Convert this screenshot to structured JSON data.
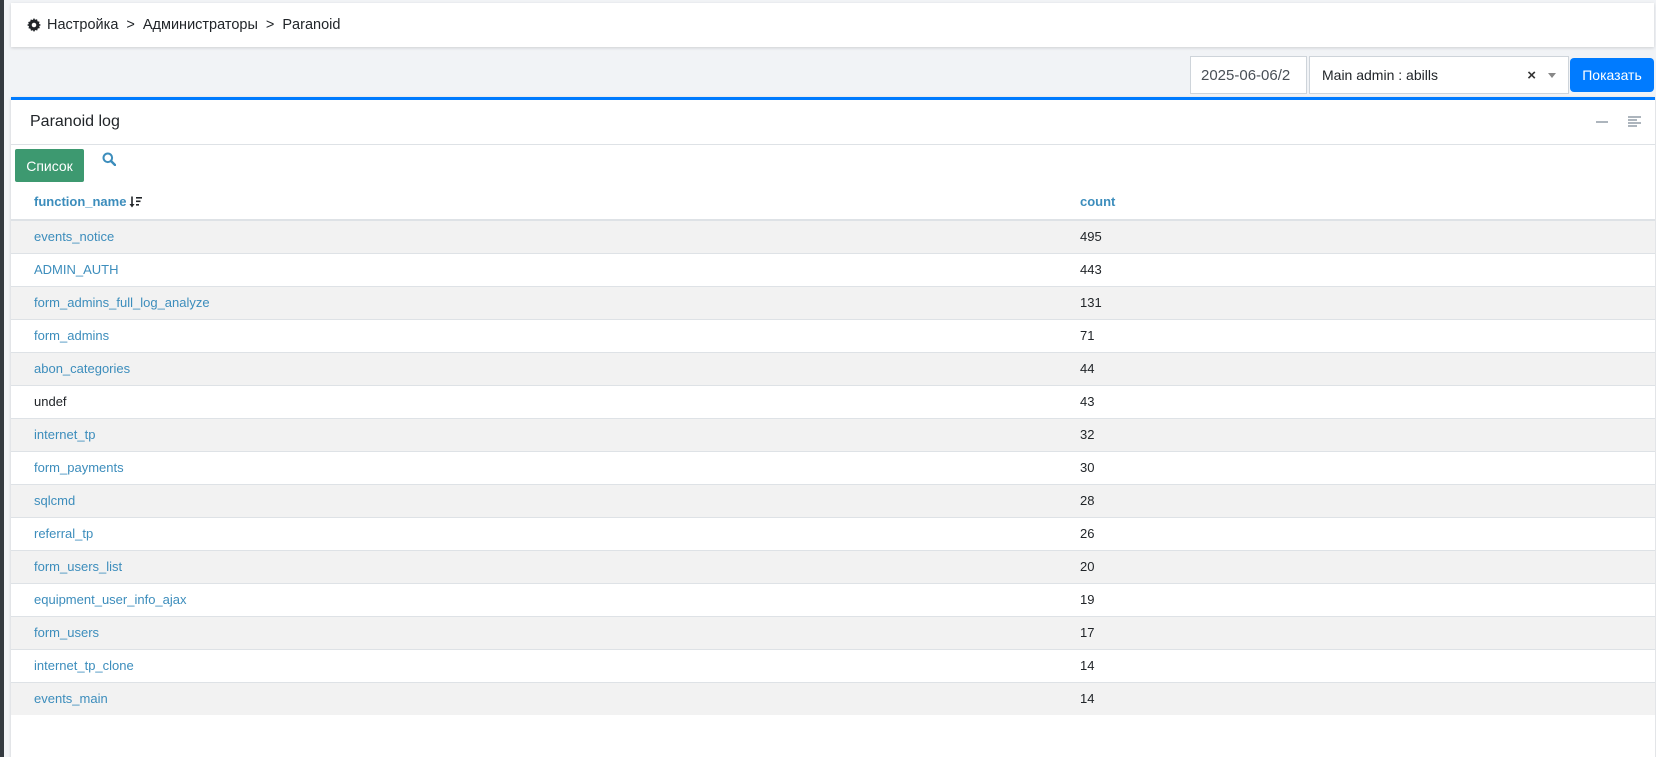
{
  "breadcrumb": {
    "items": [
      "Настройка",
      "Администраторы",
      "Paranoid"
    ],
    "separator": ">"
  },
  "filter": {
    "date_value": "2025-06-06/2",
    "admin_select_value": "Main admin : abills",
    "clear_symbol": "×",
    "show_button": "Показать"
  },
  "card": {
    "title": "Paranoid log",
    "list_button": "Список"
  },
  "table": {
    "columns": [
      "function_name",
      "count"
    ],
    "rows": [
      {
        "function_name": "events_notice",
        "count": "495",
        "link": true
      },
      {
        "function_name": "ADMIN_AUTH",
        "count": "443",
        "link": true
      },
      {
        "function_name": "form_admins_full_log_analyze",
        "count": "131",
        "link": true
      },
      {
        "function_name": "form_admins",
        "count": "71",
        "link": true
      },
      {
        "function_name": "abon_categories",
        "count": "44",
        "link": true
      },
      {
        "function_name": "undef",
        "count": "43",
        "link": false
      },
      {
        "function_name": "internet_tp",
        "count": "32",
        "link": true
      },
      {
        "function_name": "form_payments",
        "count": "30",
        "link": true
      },
      {
        "function_name": "sqlcmd",
        "count": "28",
        "link": true
      },
      {
        "function_name": "referral_tp",
        "count": "26",
        "link": true
      },
      {
        "function_name": "form_users_list",
        "count": "20",
        "link": true
      },
      {
        "function_name": "equipment_user_info_ajax",
        "count": "19",
        "link": true
      },
      {
        "function_name": "form_users",
        "count": "17",
        "link": true
      },
      {
        "function_name": "internet_tp_clone",
        "count": "14",
        "link": true
      },
      {
        "function_name": "events_main",
        "count": "14",
        "link": true
      }
    ]
  },
  "colors": {
    "primary": "#007bff",
    "link": "#3c8dbc",
    "list_button": "#3d9970",
    "row_stripe": "#f2f2f2"
  },
  "icons": {
    "breadcrumb": "gear-icon",
    "toolbar": "search-icon",
    "sort": "sort-desc-icon",
    "collapse": "minus-icon",
    "menu": "lines-icon"
  }
}
